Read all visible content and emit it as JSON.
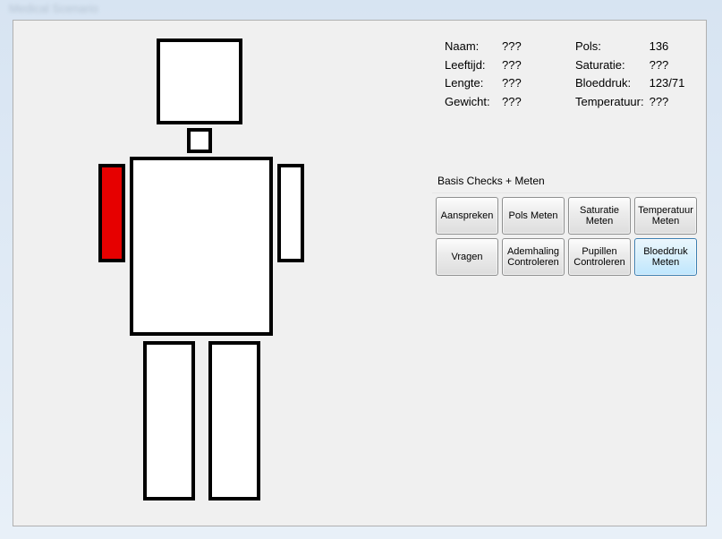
{
  "window": {
    "title_blur": "Medical Scenario"
  },
  "info": {
    "left": [
      {
        "label": "Naam:",
        "value": "???"
      },
      {
        "label": "Leeftijd:",
        "value": "???"
      },
      {
        "label": "Lengte:",
        "value": "???"
      },
      {
        "label": "Gewicht:",
        "value": "???"
      }
    ],
    "right": [
      {
        "label": "Pols:",
        "value": "136"
      },
      {
        "label": "Saturatie:",
        "value": "???"
      },
      {
        "label": "Bloeddruk:",
        "value": "123/71"
      },
      {
        "label": "Temperatuur:",
        "value": "???"
      }
    ]
  },
  "group": {
    "title": "Basis Checks + Meten",
    "buttons": [
      "Aanspreken",
      "Pols Meten",
      "Saturatie\nMeten",
      "Temperatuur\nMeten",
      "Vragen",
      "Ademhaling\nControleren",
      "Pupillen\nControleren",
      "Bloeddruk\nMeten"
    ],
    "highlighted_index": 7
  },
  "body_parts": {
    "affected": "left-upper-arm"
  }
}
